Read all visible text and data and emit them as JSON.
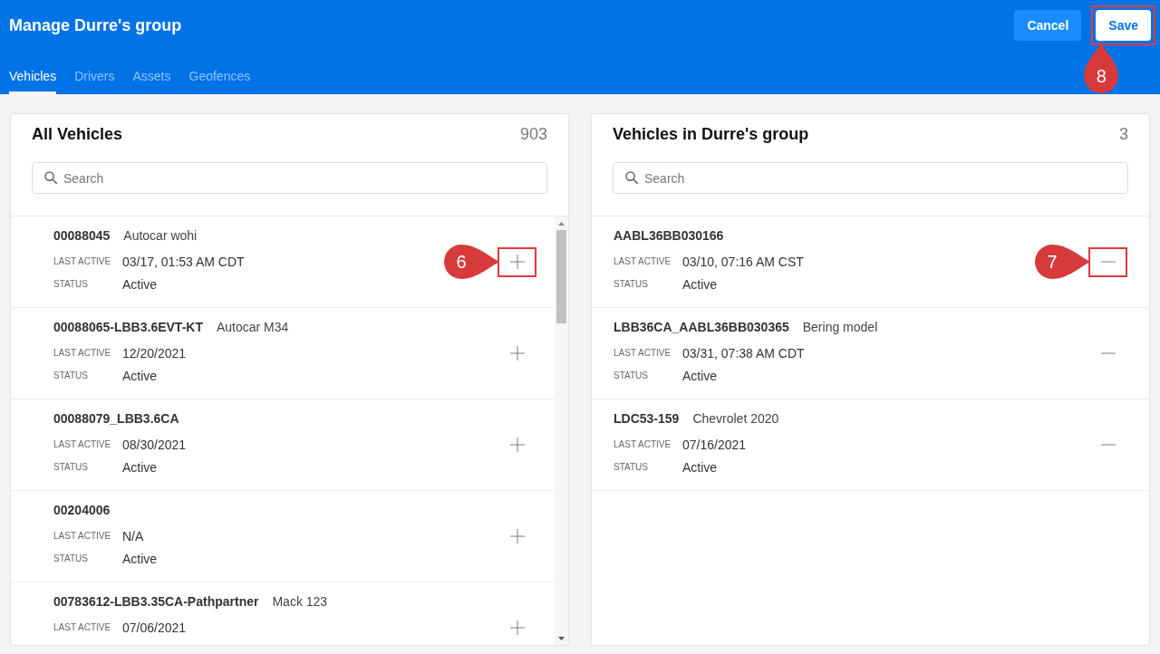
{
  "header": {
    "title": "Manage Durre's group",
    "buttons": [
      {
        "label": "Cancel",
        "kind": "secondary"
      },
      {
        "label": "Save",
        "kind": "primary",
        "callout": {
          "number": "8"
        }
      }
    ]
  },
  "tabs": [
    {
      "label": "Vehicles",
      "selected": true
    },
    {
      "label": "Drivers",
      "selected": false
    },
    {
      "label": "Assets",
      "selected": false
    },
    {
      "label": "Geofences",
      "selected": false
    }
  ],
  "panels": [
    {
      "title": "All Vehicles",
      "count": "903",
      "search": {
        "placeholder": "Search"
      },
      "kind": "add",
      "scrollbar": true,
      "items": [
        {
          "name": "00088045",
          "model": "Autocar wohi",
          "last_active_label": "LAST ACTIVE",
          "last_active": "03/17, 01:53 AM CDT",
          "status_label": "STATUS",
          "status": "Active",
          "callout": {
            "number": "6"
          }
        },
        {
          "name": "00088065-LBB3.6EVT-KT",
          "model": "Autocar M34",
          "last_active_label": "LAST ACTIVE",
          "last_active": "12/20/2021",
          "status_label": "STATUS",
          "status": "Active"
        },
        {
          "name": "00088079_LBB3.6CA",
          "last_active_label": "LAST ACTIVE",
          "last_active": "08/30/2021",
          "status_label": "STATUS",
          "status": "Active"
        },
        {
          "name": "00204006",
          "last_active_label": "LAST ACTIVE",
          "last_active": "N/A",
          "status_label": "STATUS",
          "status": "Active"
        },
        {
          "name": "00783612-LBB3.35CA-Pathpartner",
          "model": "Mack 123",
          "last_active_label": "LAST ACTIVE",
          "last_active": "07/06/2021"
        }
      ]
    },
    {
      "title": "Vehicles in Durre's group",
      "count": "3",
      "search": {
        "placeholder": "Search"
      },
      "kind": "remove",
      "items": [
        {
          "name": "AABL36BB030166",
          "last_active_label": "LAST ACTIVE",
          "last_active": "03/10, 07:16 AM CST",
          "status_label": "STATUS",
          "status": "Active",
          "callout": {
            "number": "7"
          }
        },
        {
          "name": "LBB36CA_AABL36BB030365",
          "model": "Bering model",
          "last_active_label": "LAST ACTIVE",
          "last_active": "03/31, 07:38 AM CDT",
          "status_label": "STATUS",
          "status": "Active"
        },
        {
          "name": "LDC53-159",
          "model": "Chevrolet 2020",
          "last_active_label": "LAST ACTIVE",
          "last_active": "07/16/2021",
          "status_label": "STATUS",
          "status": "Active"
        }
      ]
    }
  ]
}
